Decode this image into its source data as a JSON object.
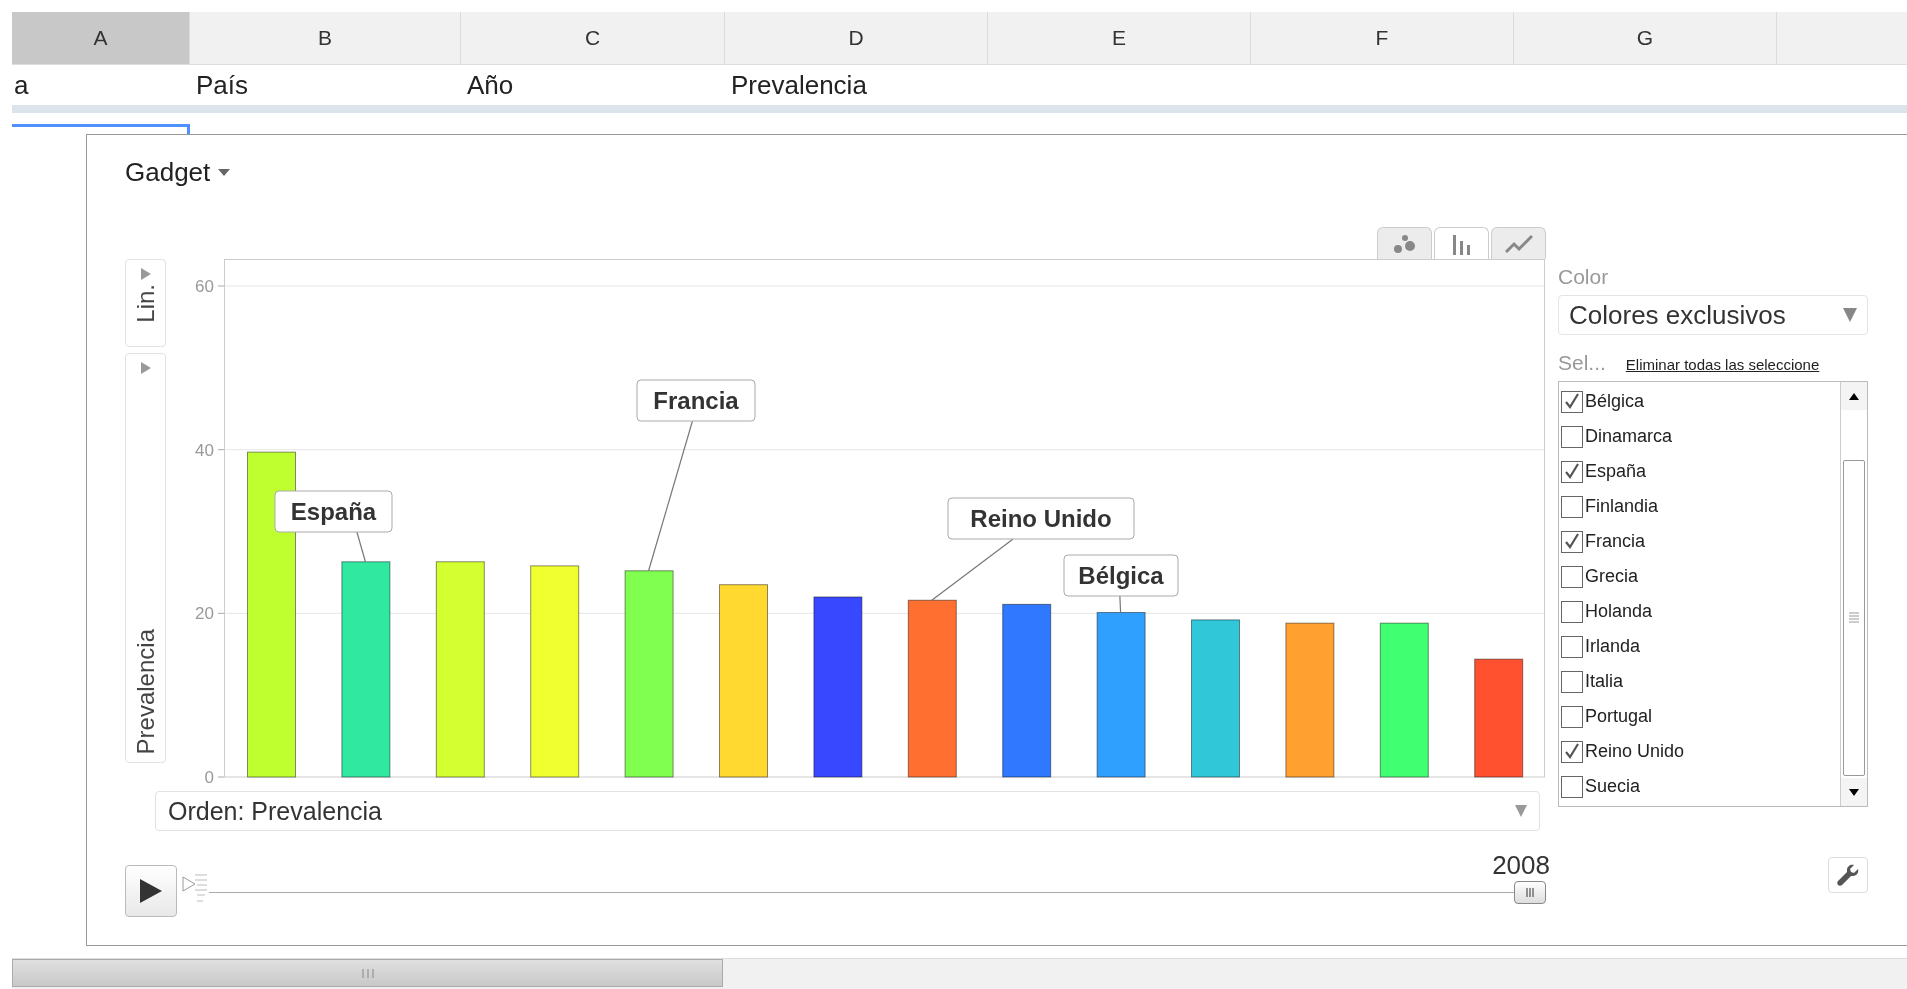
{
  "sheet": {
    "columns": [
      {
        "label": "A",
        "selected": true
      },
      {
        "label": "B",
        "selected": false
      },
      {
        "label": "C",
        "selected": false
      },
      {
        "label": "D",
        "selected": false
      },
      {
        "label": "E",
        "selected": false
      },
      {
        "label": "F",
        "selected": false
      },
      {
        "label": "G",
        "selected": false
      }
    ],
    "row_1": [
      "a",
      "País",
      "Año",
      "Prevalencia"
    ]
  },
  "gadget": {
    "title": "Gadget",
    "chart_types": [
      {
        "kind": "bubble",
        "selected": false
      },
      {
        "kind": "bar",
        "selected": true
      },
      {
        "kind": "line",
        "selected": false
      }
    ],
    "y_axis": {
      "scale": "Lin."
    },
    "chart_data": {
      "type": "bar",
      "ylabel": "Prevalencia",
      "ylim": [
        0,
        63.3
      ],
      "yticks": [
        0,
        20,
        40,
        60
      ],
      "grid": true,
      "values": [
        39.7,
        26.3,
        26.3,
        25.8,
        25.2,
        23.5,
        22.0,
        21.6,
        21.1,
        20.1,
        19.2,
        18.8,
        18.8,
        14.4
      ],
      "colors": [
        "#bfff30",
        "#30e8a0",
        "#d4ff30",
        "#f0ff30",
        "#80ff50",
        "#ffd830",
        "#3848ff",
        "#ff7030",
        "#3078ff",
        "#30a0ff",
        "#30c8d8",
        "#ffa030",
        "#40ff70",
        "#ff5030"
      ],
      "annotations": [
        "España",
        "Francia",
        "Reino Unido",
        "Bélgica"
      ]
    },
    "order": "Orden: Prevalencia",
    "timeline": {
      "year": "2008",
      "level": 1
    },
    "color": {
      "label": "Color",
      "value": "Colores exclusivos"
    },
    "selection": {
      "label": "Sel...",
      "clear_link": "Eliminar todas las seleccione",
      "items": [
        {
          "name": "Bélgica",
          "checked": true
        },
        {
          "name": "Dinamarca",
          "checked": false
        },
        {
          "name": "España",
          "checked": true
        },
        {
          "name": "Finlandia",
          "checked": false
        },
        {
          "name": "Francia",
          "checked": true
        },
        {
          "name": "Grecia",
          "checked": false
        },
        {
          "name": "Holanda",
          "checked": false
        },
        {
          "name": "Irlanda",
          "checked": false
        },
        {
          "name": "Italia",
          "checked": false
        },
        {
          "name": "Portugal",
          "checked": false
        },
        {
          "name": "Reino Unido",
          "checked": true
        },
        {
          "name": "Suecia",
          "checked": false
        }
      ]
    }
  }
}
